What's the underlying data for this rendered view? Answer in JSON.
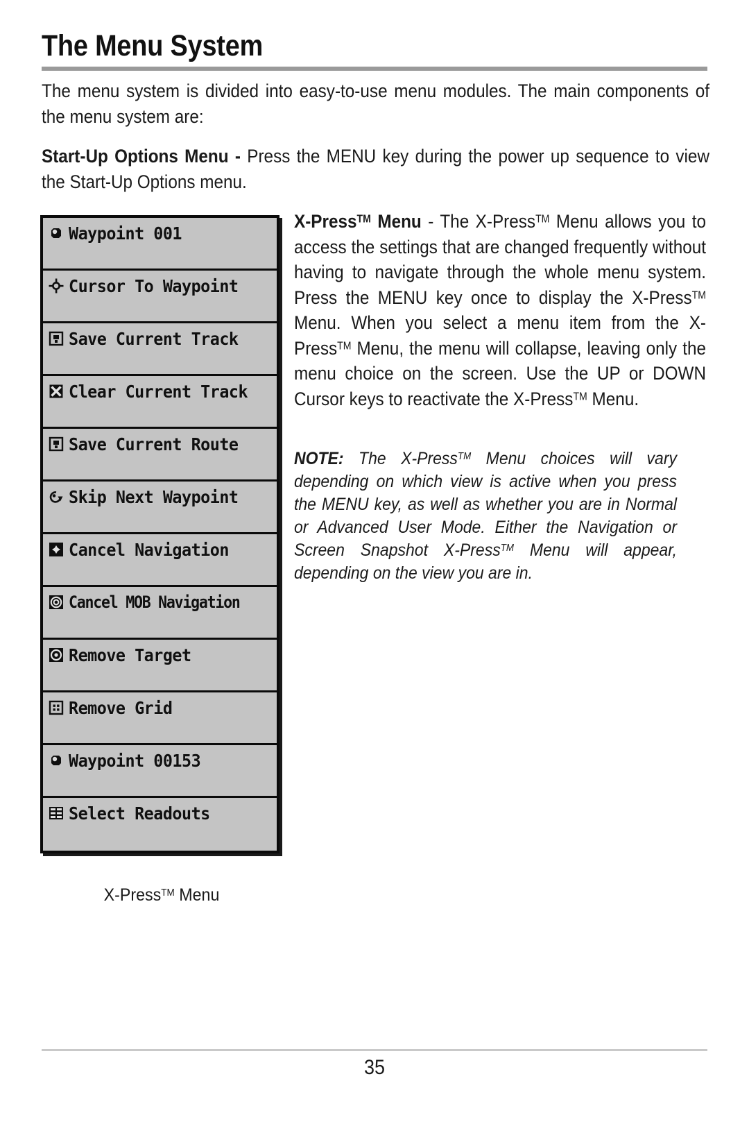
{
  "document": {
    "chapter_title": "The Menu System",
    "page_number": "35"
  },
  "body": {
    "intro_paragraph": "The menu system is divided into easy-to-use menu modules. The main components of the menu system are:",
    "startup_label": "Start-Up Options Menu - ",
    "startup_text": "Press the MENU key during the power up sequence to view the Start-Up Options menu.",
    "xpress_label_part1": "X-Press",
    "xpress_label_tm": "TM",
    "xpress_label_part2": " Menu",
    "xpress_dash": " - ",
    "xpress_text_a": "The X-Press",
    "xpress_text_b": " Menu allows you to access the settings that are changed frequently without having to navigate through the whole menu system. Press the MENU key once to display the X-Press",
    "xpress_text_c": " Menu. When you select a menu item from the X-Press",
    "xpress_text_d": " Menu, the menu will collapse, leaving only the menu choice on the screen. Use the UP or DOWN Cursor keys to reactivate the X-Press",
    "xpress_text_e": " Menu.",
    "note_label": "NOTE:",
    "note_text_a": " The X-Press",
    "note_text_b": " Menu choices will vary depending on which view is active when you press the MENU key, as well as whether you are in Normal or Advanced User Mode. Either the Navigation or Screen Snapshot X-Press",
    "note_text_c": " Menu will appear, depending on the view you are in."
  },
  "figure": {
    "caption_text": "X-Press",
    "caption_tm": "TM",
    "caption_suffix": " Menu",
    "panel_background": "#c4c4c4",
    "panel_border": "#0a0a0a",
    "menu_items": [
      {
        "label": "Waypoint 001",
        "icon": "waypoint-icon"
      },
      {
        "label": "Cursor To Waypoint",
        "icon": "crosshair-icon"
      },
      {
        "label": "Save Current Track",
        "icon": "floppy-disk-icon"
      },
      {
        "label": "Clear Current Track",
        "icon": "x-box-icon"
      },
      {
        "label": "Save Current Route",
        "icon": "floppy-disk-icon"
      },
      {
        "label": "Skip Next Waypoint",
        "icon": "skip-arrow-icon"
      },
      {
        "label": "Cancel Navigation",
        "icon": "compass-diamond-icon"
      },
      {
        "label": "Cancel MOB Navigation",
        "icon": "target-rings-icon"
      },
      {
        "label": "Remove Target",
        "icon": "target-rings-icon"
      },
      {
        "label": "Remove Grid",
        "icon": "grid-icon"
      },
      {
        "label": "Waypoint 00153",
        "icon": "waypoint-icon"
      },
      {
        "label": "Select Readouts",
        "icon": "readouts-icon"
      }
    ]
  }
}
